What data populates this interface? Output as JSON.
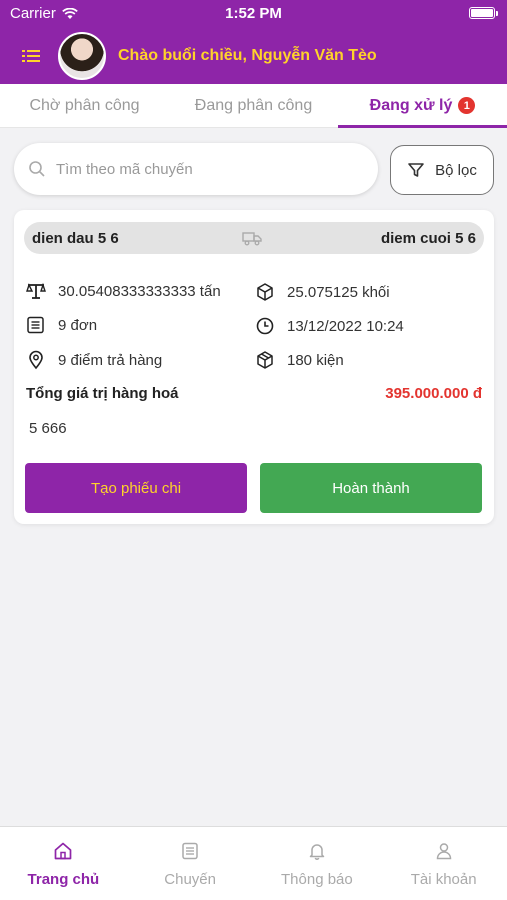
{
  "status_bar": {
    "carrier": "Carrier",
    "time": "1:52 PM"
  },
  "header": {
    "greeting": "Chào buổi chiều, Nguyễn Văn Tèo"
  },
  "tabs": [
    {
      "label": "Chờ phân công",
      "active": false
    },
    {
      "label": "Đang phân công",
      "active": false
    },
    {
      "label": "Đang xử lý",
      "active": true,
      "badge": "1"
    }
  ],
  "search": {
    "placeholder": "Tìm theo mã chuyến"
  },
  "filter": {
    "label": "Bộ lọc"
  },
  "trip": {
    "origin": "dien dau 5 6",
    "destination": "diem cuoi 5 6",
    "weight": "30.05408333333333 tấn",
    "volume": "25.075125 khối",
    "orders": "9 đơn",
    "datetime": "13/12/2022 10:24",
    "drop_points": "9 điểm trả hàng",
    "packages": "180 kiện",
    "total_label": "Tổng giá trị hàng hoá",
    "total_value": "395.000.000 đ",
    "note": "5 666",
    "create_voucher_label": "Tạo phiếu chi",
    "complete_label": "Hoàn thành"
  },
  "bottom_nav": [
    {
      "label": "Trang chủ",
      "icon": "home-icon",
      "active": true
    },
    {
      "label": "Chuyến",
      "icon": "list-icon",
      "active": false
    },
    {
      "label": "Thông báo",
      "icon": "bell-icon",
      "active": false
    },
    {
      "label": "Tài khoản",
      "icon": "user-icon",
      "active": false
    }
  ],
  "colors": {
    "primary": "#8e25a8",
    "accent": "#ffd32a",
    "success": "#43a853",
    "danger": "#e3342f"
  }
}
